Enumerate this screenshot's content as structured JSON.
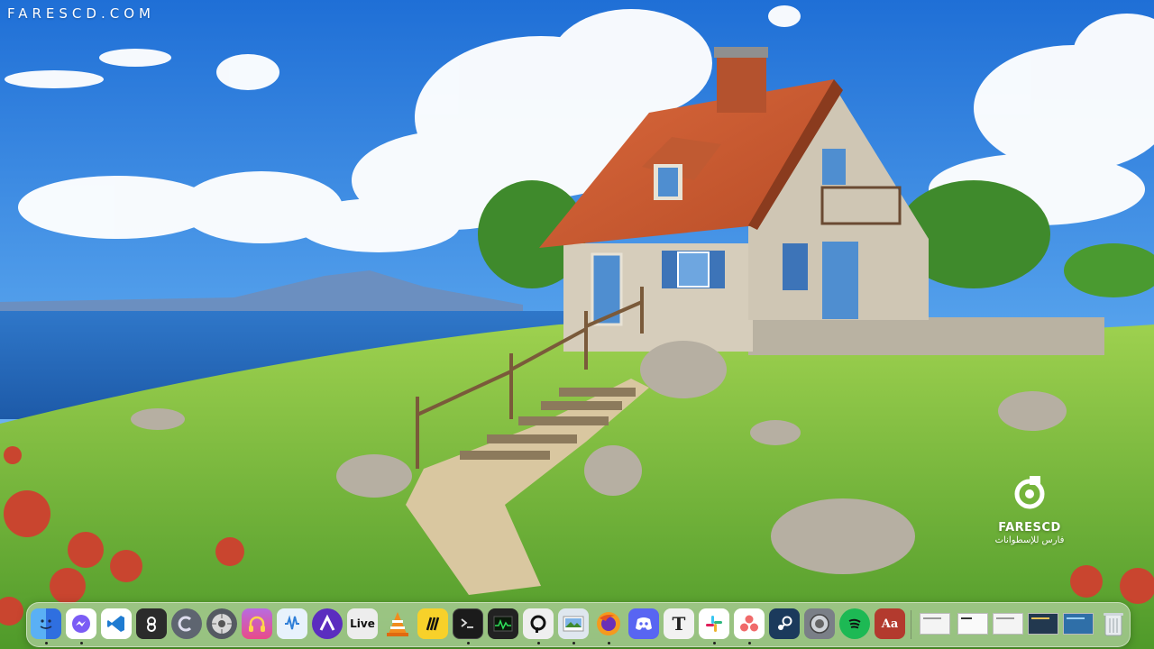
{
  "watermark": {
    "site": "FARESCD.COM"
  },
  "brand": {
    "name": "FARESCD",
    "arabic": "فارس للإسطوانات",
    "icon": "farescd-logo"
  },
  "wallpaper": {
    "icon": "wallpaper-landscape"
  },
  "dock": {
    "apps": [
      {
        "name": "Finder",
        "icon": "finder-icon",
        "running": true,
        "color": "#3a8ee6"
      },
      {
        "name": "Messenger",
        "icon": "messenger-icon",
        "running": true,
        "color": "#7b5cf5"
      },
      {
        "name": "Visual Studio Code",
        "icon": "vscode-icon",
        "running": false,
        "color": "#1f7bd1"
      },
      {
        "name": "Infuse",
        "icon": "infuse-icon",
        "running": false,
        "color": "#2b2b2b"
      },
      {
        "name": "Codepoint",
        "icon": "codepoint-icon",
        "running": false,
        "color": "#5e6570"
      },
      {
        "name": "Disk Utility",
        "icon": "disk-utility-icon",
        "running": false,
        "color": "#6b6f76"
      },
      {
        "name": "Podcast App",
        "icon": "headphones-icon",
        "running": false,
        "color": "#d94fa8"
      },
      {
        "name": "Waves Audio",
        "icon": "audio-wave-icon",
        "running": false,
        "color": "#3c8de0"
      },
      {
        "name": "Arc",
        "icon": "arc-icon",
        "running": false,
        "color": "#5b2dbf"
      },
      {
        "name": "Ableton Live",
        "icon": "ableton-live-icon",
        "running": false,
        "label": "Live",
        "color": "#1c1c1c"
      },
      {
        "name": "VLC",
        "icon": "vlc-icon",
        "running": false,
        "color": "#f28c1e"
      },
      {
        "name": "Miro",
        "icon": "miro-icon",
        "running": false,
        "color": "#f7d12a"
      },
      {
        "name": "Terminal",
        "icon": "terminal-icon",
        "running": true,
        "color": "#1b1b1b"
      },
      {
        "name": "Activity Monitor",
        "icon": "activity-monitor-icon",
        "running": false,
        "color": "#222"
      },
      {
        "name": "Proxyman",
        "icon": "proxyman-icon",
        "running": true,
        "color": "#efefef"
      },
      {
        "name": "Preview",
        "icon": "preview-icon",
        "running": true,
        "color": "#4f8fcf"
      },
      {
        "name": "Firefox",
        "icon": "firefox-icon",
        "running": true,
        "color": "#e8561e"
      },
      {
        "name": "Discord",
        "icon": "discord-icon",
        "running": false,
        "color": "#5865f2"
      },
      {
        "name": "Typora",
        "icon": "typora-icon",
        "running": false,
        "label": "T",
        "color": "#f2f2f2"
      },
      {
        "name": "Slack",
        "icon": "slack-icon",
        "running": true,
        "color": "#ffffff"
      },
      {
        "name": "Asana",
        "icon": "asana-icon",
        "running": true,
        "color": "#f06a6a"
      },
      {
        "name": "Steam",
        "icon": "steam-icon",
        "running": false,
        "color": "#1b3a5c"
      },
      {
        "name": "System Settings",
        "icon": "system-settings-icon",
        "running": false,
        "color": "#7a7f87"
      },
      {
        "name": "Spotify",
        "icon": "spotify-icon",
        "running": false,
        "color": "#1db954"
      },
      {
        "name": "Dictionary",
        "icon": "dictionary-icon",
        "running": false,
        "label": "Aa",
        "color": "#b33a2e"
      }
    ],
    "windows": [
      {
        "icon": "window-thumbnail-1"
      },
      {
        "icon": "window-thumbnail-2"
      },
      {
        "icon": "window-thumbnail-3"
      },
      {
        "icon": "window-thumbnail-4"
      },
      {
        "icon": "window-thumbnail-5"
      }
    ],
    "trash": {
      "icon": "trash-icon"
    }
  }
}
